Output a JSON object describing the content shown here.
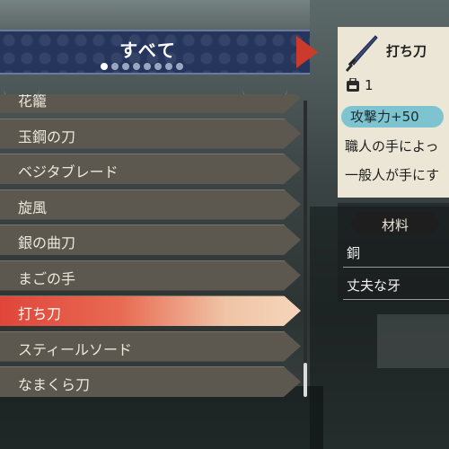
{
  "header": {
    "title": "すべて",
    "page_dots_total": 8,
    "page_dots_active": 0
  },
  "list": {
    "items": [
      {
        "label": "花籠"
      },
      {
        "label": "玉鋼の刀"
      },
      {
        "label": "ベジタブレード"
      },
      {
        "label": "旋風"
      },
      {
        "label": "銀の曲刀"
      },
      {
        "label": "まごの手"
      },
      {
        "label": "打ち刀"
      },
      {
        "label": "スティールソード"
      },
      {
        "label": "なまくら刀"
      }
    ],
    "selected_index": 6
  },
  "detail": {
    "name": "打ち刀",
    "owned_count": "1",
    "attack": "攻撃力+50",
    "description_line1": "職人の手によっ",
    "description_line2": "一般人が手にす"
  },
  "materials": {
    "title": "材料",
    "items": [
      "銅",
      "丈夫な牙"
    ]
  },
  "colors": {
    "header_bg": "#26355c",
    "accent_red": "#cc3a2c",
    "selected_gradient_start": "#e0453a",
    "attack_badge": "#7ec4d0",
    "list_item_bg": "#5c5850"
  },
  "icons": {
    "weapon": "katana-icon",
    "owned": "backpack-icon"
  }
}
